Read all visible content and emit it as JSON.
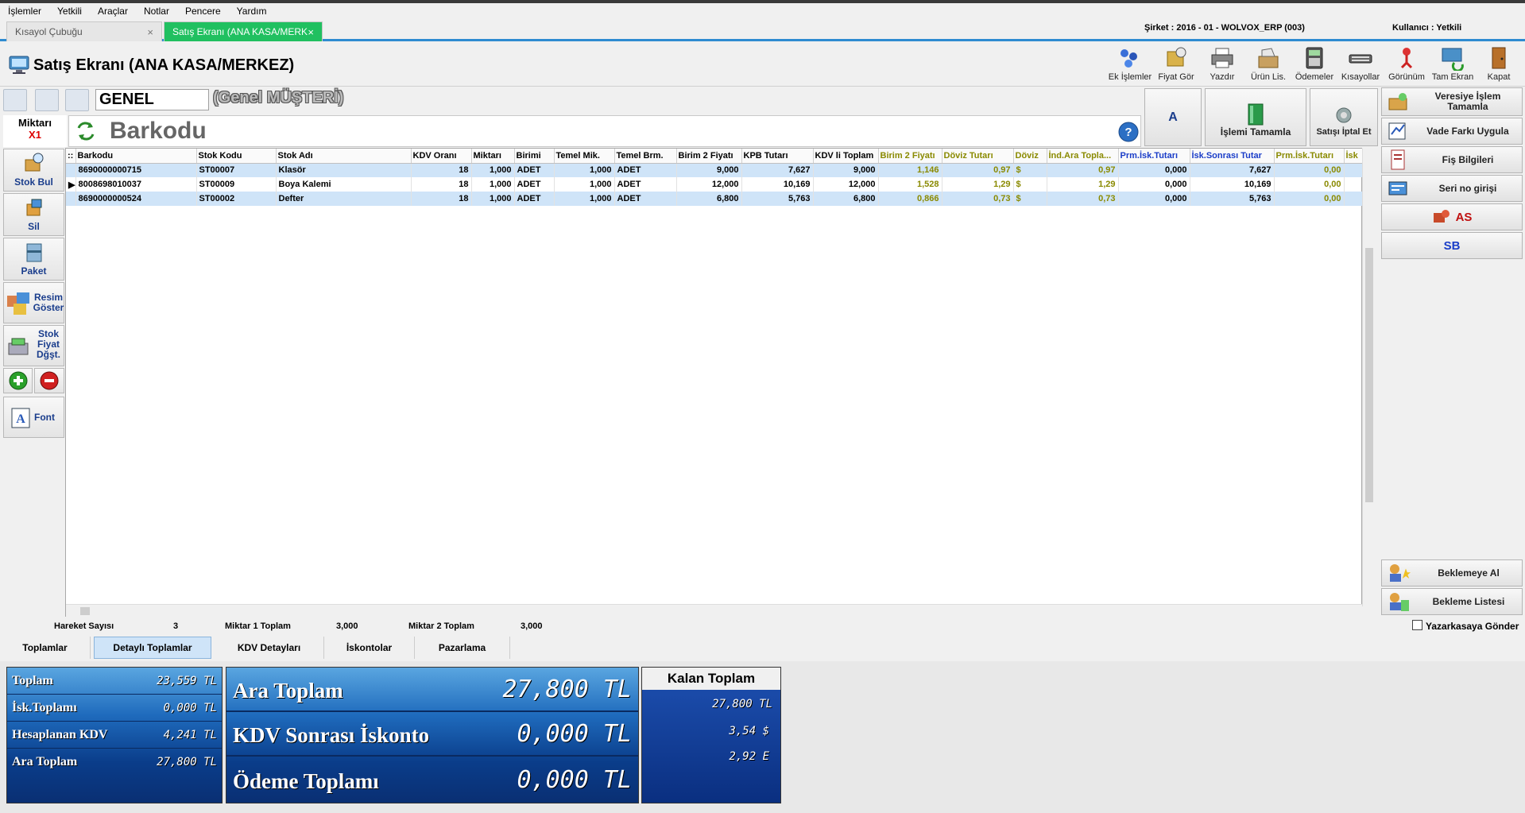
{
  "menu": [
    "İşlemler",
    "Yetkili",
    "Araçlar",
    "Notlar",
    "Pencere",
    "Yardım"
  ],
  "tabs": [
    {
      "label": "Kısayol Çubuğu",
      "close": "×"
    },
    {
      "label": "Satış Ekranı (ANA KASA/MERK",
      "close": "×"
    }
  ],
  "company": "Şirket : 2016 - 01 - WOLVOX_ERP (003)",
  "user": "Kullanıcı : Yetkili",
  "page_title": "Satış Ekranı (ANA KASA/MERKEZ)",
  "toolbar": [
    {
      "label": "Ek İşlemler",
      "icon": "extra-ops-icon"
    },
    {
      "label": "Fiyat Gör",
      "icon": "price-view-icon"
    },
    {
      "label": "Yazdır",
      "icon": "printer-icon"
    },
    {
      "label": "Ürün Lis.",
      "icon": "product-list-icon"
    },
    {
      "label": "Ödemeler",
      "icon": "payments-icon"
    },
    {
      "label": "Kısayollar",
      "icon": "shortcuts-icon"
    },
    {
      "label": "Görünüm",
      "icon": "view-icon"
    },
    {
      "label": "Tam Ekran",
      "icon": "fullscreen-icon"
    },
    {
      "label": "Kapat",
      "icon": "close-door-icon"
    }
  ],
  "customer": {
    "code": "GENEL",
    "name": "(Genel MÜŞTERİ)"
  },
  "barcode_label": "Barkodu",
  "miktar": {
    "label": "Miktarı",
    "value": "X1"
  },
  "left_buttons": [
    {
      "label": "Stok Bul",
      "icon": "stock-search-icon"
    },
    {
      "label": "Sil",
      "icon": "delete-icon"
    },
    {
      "label": "Paket",
      "icon": "package-icon"
    },
    {
      "label": "Resim Göster",
      "icon": "image-show-icon"
    },
    {
      "label": "Stok Fiyat Dğşt.",
      "icon": "price-change-icon"
    },
    {
      "label": "Font",
      "icon": "font-icon"
    }
  ],
  "mid_buttons": {
    "a": "A",
    "complete": "İşlemi Tamamla",
    "cancel": "Satışı İptal Et"
  },
  "grid": {
    "columns": [
      "Barkodu",
      "Stok Kodu",
      "Stok Adı",
      "KDV Oranı",
      "Miktarı",
      "Birimi",
      "Temel Mik.",
      "Temel Brm.",
      "Birim 2 Fiyatı",
      "KPB Tutarı",
      "KDV li Toplam",
      "Birim 2 Fiyatı",
      "Döviz Tutarı",
      "Döviz",
      "İnd.Ara Topla...",
      "Prm.İsk.Tutarı",
      "İsk.Sonrası Tutar",
      "Prm.İsk.Tutarı",
      "İsk"
    ],
    "rows": [
      [
        "8690000000715",
        "ST00007",
        "Klasör",
        "18",
        "1,000",
        "ADET",
        "1,000",
        "ADET",
        "9,000",
        "7,627",
        "9,000",
        "1,146",
        "0,97",
        "$",
        "0,97",
        "0,000",
        "7,627",
        "0,00"
      ],
      [
        "8008698010037",
        "ST00009",
        "Boya Kalemi",
        "18",
        "1,000",
        "ADET",
        "1,000",
        "ADET",
        "12,000",
        "10,169",
        "12,000",
        "1,528",
        "1,29",
        "$",
        "1,29",
        "0,000",
        "10,169",
        "0,00"
      ],
      [
        "8690000000524",
        "ST00002",
        "Defter",
        "18",
        "1,000",
        "ADET",
        "1,000",
        "ADET",
        "6,800",
        "5,763",
        "6,800",
        "0,866",
        "0,73",
        "$",
        "0,73",
        "0,000",
        "5,763",
        "0,00"
      ]
    ]
  },
  "right_buttons": [
    {
      "label": "Veresiye İşlem Tamamla",
      "icon": "credit-complete-icon"
    },
    {
      "label": "Vade Farkı Uygula",
      "icon": "due-diff-icon"
    },
    {
      "label": "Fiş Bilgileri",
      "icon": "receipt-info-icon"
    },
    {
      "label": "Seri no girişi",
      "icon": "serial-entry-icon"
    },
    {
      "label": "AS",
      "icon": "as-icon"
    },
    {
      "label": "SB",
      "icon": ""
    },
    {
      "label": "Beklemeye Al",
      "icon": "hold-icon"
    },
    {
      "label": "Bekleme Listesi",
      "icon": "hold-list-icon"
    }
  ],
  "status": {
    "hareket_label": "Hareket Sayısı",
    "hareket_value": "3",
    "m1_label": "Miktar 1 Toplam",
    "m1_value": "3,000",
    "m2_label": "Miktar 2 Toplam",
    "m2_value": "3,000",
    "yazarkasa": "Yazarkasaya Gönder"
  },
  "bottom_tabs": [
    "Toplamlar",
    "Detaylı Toplamlar",
    "KDV Detayları",
    "İskontolar",
    "Pazarlama"
  ],
  "totals_small": [
    {
      "label": "Toplam",
      "value": "23,559 TL"
    },
    {
      "label": "İsk.Toplamı",
      "value": "0,000 TL"
    },
    {
      "label": "Hesaplanan KDV",
      "value": "4,241 TL"
    },
    {
      "label": "Ara Toplam",
      "value": "27,800 TL"
    }
  ],
  "totals_big": [
    {
      "label": "Ara Toplam",
      "value": "27,800 TL"
    },
    {
      "label": "KDV Sonrası İskonto",
      "value": "0,000 TL"
    },
    {
      "label": "Ödeme Toplamı",
      "value": "0,000 TL"
    }
  ],
  "kalan": {
    "title": "Kalan Toplam",
    "values": [
      "27,800 TL",
      "3,54 $",
      "2,92 E"
    ]
  }
}
